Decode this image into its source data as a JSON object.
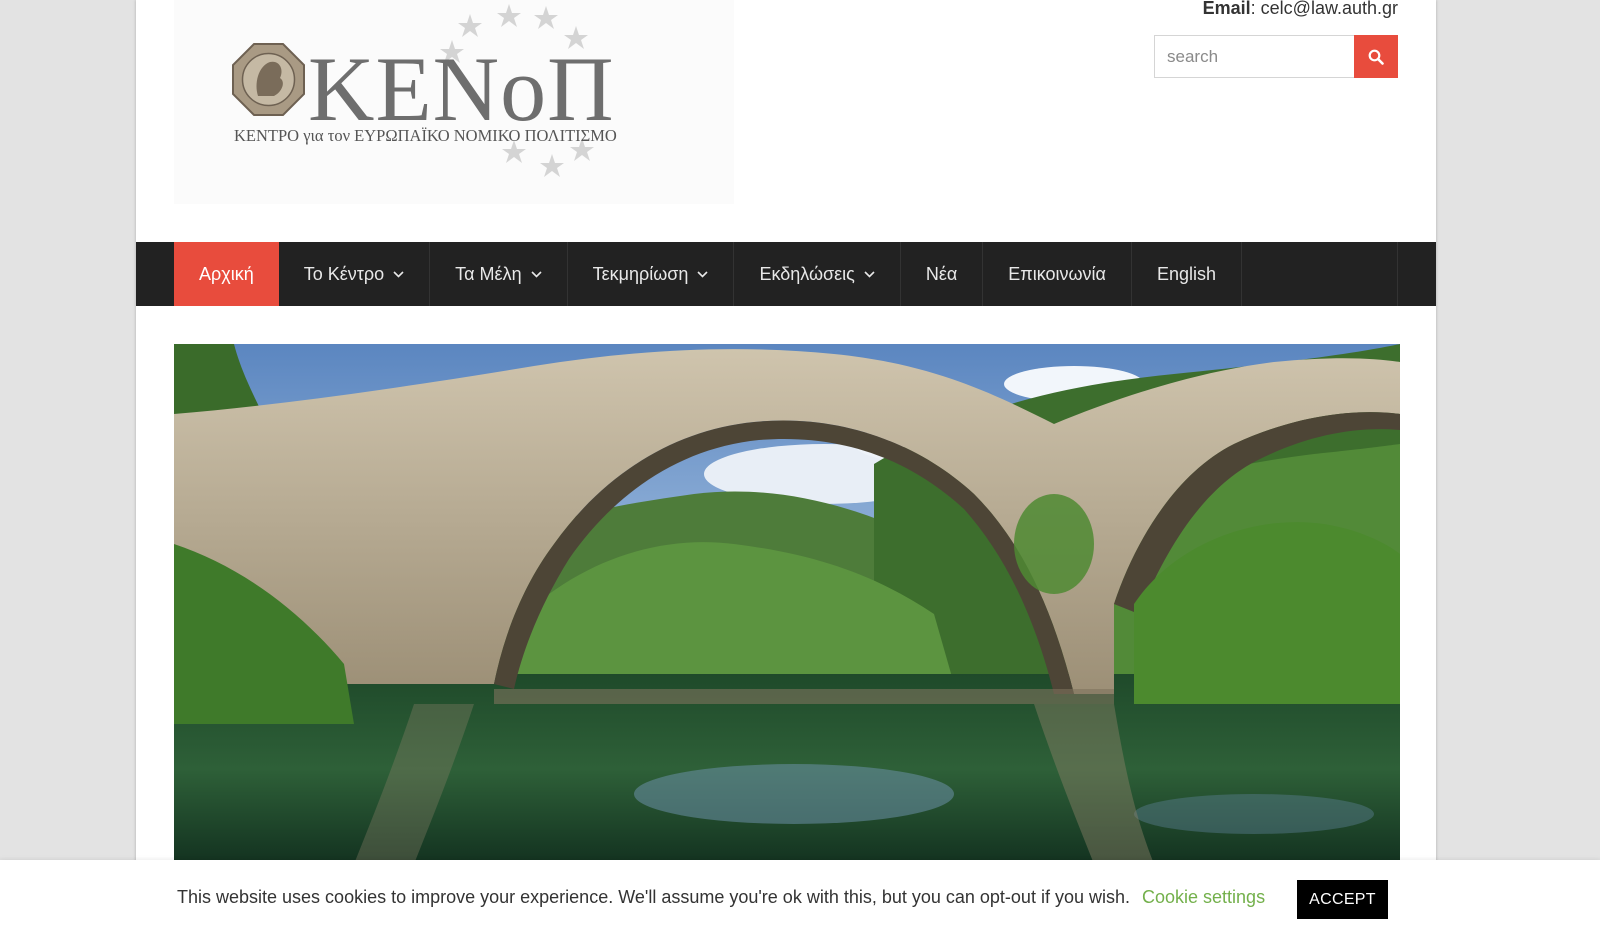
{
  "header": {
    "logo_title": "ΚΕΝοΠ",
    "logo_subtitle": "ΚΕΝΤΡΟ για τον ΕΥΡΩΠΑΪΚΟ ΝΟΜΙΚΟ ΠΟΛΙΤΙΣΜΟ",
    "email_label": "Email",
    "email_value": ": celc@law.auth.gr",
    "search_placeholder": "search"
  },
  "nav": {
    "items": [
      {
        "label": "Αρχική",
        "active": true
      },
      {
        "label": "Το Κέντρο",
        "dropdown": true
      },
      {
        "label": "Τα Μέλη",
        "dropdown": true
      },
      {
        "label": "Τεκμηρίωση",
        "dropdown": true
      },
      {
        "label": "Εκδηλώσεις",
        "dropdown": true
      },
      {
        "label": "Νέα"
      },
      {
        "label": "Επικοινωνία"
      },
      {
        "label": "English"
      }
    ]
  },
  "cookie": {
    "text": "This website uses cookies to improve your experience. We'll assume you're ok with this, but you can opt-out if you wish.",
    "settings_label": "Cookie settings",
    "accept_label": "ACCEPT"
  },
  "colors": {
    "accent": "#e84c3d",
    "nav_bg": "#222222",
    "cookie_link": "#73b04b"
  },
  "icons": {
    "search": "search-icon",
    "dropdown": "chevron-down-icon"
  }
}
